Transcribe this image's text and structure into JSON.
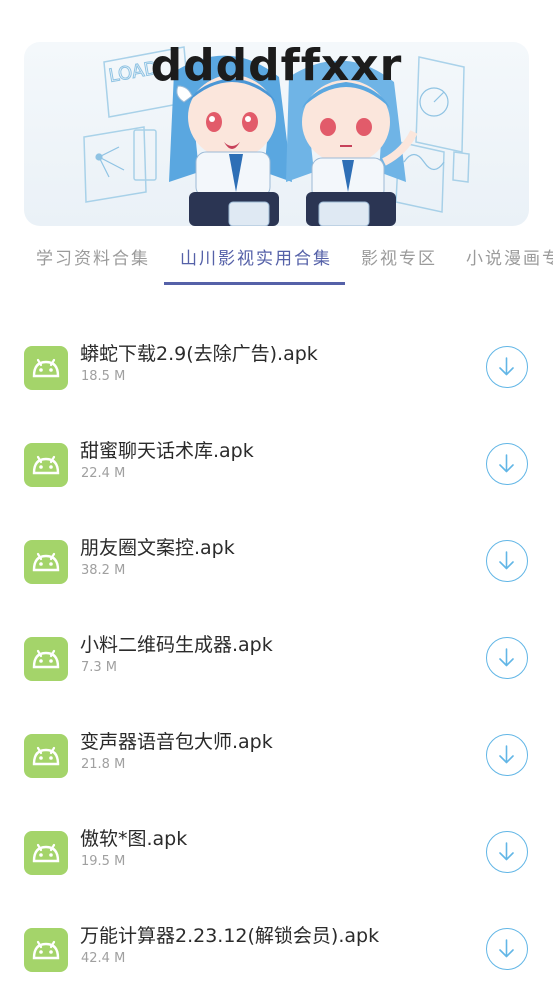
{
  "banner": {
    "title": "ddddffxxr",
    "artwork_text": "LOAD"
  },
  "tabs": [
    {
      "label": "学习资料合集",
      "active": false
    },
    {
      "label": "山川影视实用合集",
      "active": true
    },
    {
      "label": "影视专区",
      "active": false
    },
    {
      "label": "小说漫画专",
      "active": false
    }
  ],
  "files": [
    {
      "name": "蟒蛇下载2.9(去除广告).apk",
      "size": "18.5 M"
    },
    {
      "name": "甜蜜聊天话术库.apk",
      "size": "22.4 M"
    },
    {
      "name": "朋友圈文案控.apk",
      "size": "38.2 M"
    },
    {
      "name": "小料二维码生成器.apk",
      "size": "7.3 M"
    },
    {
      "name": "变声器语音包大师.apk",
      "size": "21.8 M"
    },
    {
      "name": "傲软*图.apk",
      "size": "19.5 M"
    },
    {
      "name": "万能计算器2.23.12(解锁会员).apk",
      "size": "42.4 M"
    }
  ],
  "icons": {
    "file_icon": "android-icon",
    "action_icon": "download-icon"
  },
  "colors": {
    "accent": "#5561a8",
    "android_green": "#a4d46a",
    "download_blue": "#62b6e6"
  }
}
